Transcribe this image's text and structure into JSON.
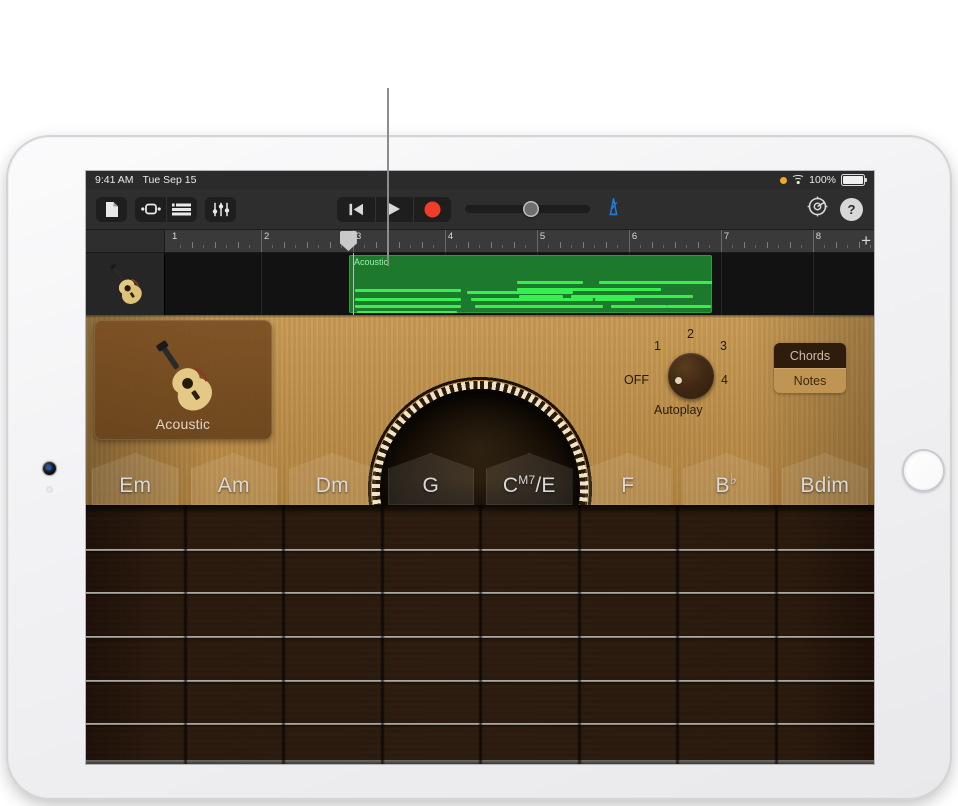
{
  "callout": {
    "name": "callout-line"
  },
  "device": {
    "name": "iPad",
    "camera_icon": "camera-icon",
    "home_button": "home-button"
  },
  "status_bar": {
    "time": "9:41 AM",
    "date": "Tue Sep 15",
    "focus_indicator": "orange-dot-icon",
    "wifi_icon": "wifi-icon",
    "battery_percent": "100%",
    "battery_icon": "battery-icon"
  },
  "toolbar": {
    "left_buttons": [
      {
        "name": "my-songs-button",
        "icon": "document-icon",
        "label": "My Songs"
      },
      {
        "name": "loop-browser-button",
        "icon": "loop-browser-icon",
        "label": "Loop Browser"
      },
      {
        "name": "track-view-button",
        "icon": "tracks-view-icon",
        "label": "Tracks View"
      },
      {
        "name": "mixer-button",
        "icon": "mixer-sliders-icon",
        "label": "Mixer"
      }
    ],
    "transport": [
      {
        "name": "rewind-button",
        "icon": "rewind-icon",
        "label": "Go to Beginning"
      },
      {
        "name": "play-button",
        "icon": "play-icon",
        "label": "Play"
      },
      {
        "name": "record-button",
        "icon": "record-icon",
        "label": "Record"
      }
    ],
    "volume": {
      "label": "Master Volume",
      "value": 46
    },
    "metronome": {
      "name": "metronome-button",
      "icon": "metronome-icon",
      "label": "Metronome"
    },
    "settings": {
      "name": "settings-button",
      "icon": "gear-icon",
      "label": "Song Settings"
    },
    "help": {
      "name": "help-button",
      "icon": "question-mark-icon",
      "label": "?"
    }
  },
  "ruler": {
    "bars": [
      "1",
      "2",
      "3",
      "4",
      "5",
      "6",
      "7",
      "8"
    ],
    "playhead_bar": "3",
    "add_track_label": "+"
  },
  "track": {
    "header_icon": "acoustic-guitar-icon",
    "region_name": "Acoustic"
  },
  "instrument": {
    "card_label": "Acoustic",
    "card_icon": "acoustic-guitar-icon"
  },
  "autoplay": {
    "label": "Autoplay",
    "off_label": "OFF",
    "positions": [
      "1",
      "2",
      "3",
      "4"
    ],
    "selected": "OFF"
  },
  "mode_switch": {
    "chords_label": "Chords",
    "notes_label": "Notes",
    "selected": "Notes"
  },
  "chord_strip": {
    "chords": [
      {
        "root": "Em",
        "sup": "",
        "bass": ""
      },
      {
        "root": "Am",
        "sup": "",
        "bass": ""
      },
      {
        "root": "Dm",
        "sup": "",
        "bass": ""
      },
      {
        "root": "G",
        "sup": "",
        "bass": ""
      },
      {
        "root": "C",
        "sup": "M7",
        "bass": "/E"
      },
      {
        "root": "F",
        "sup": "",
        "bass": ""
      },
      {
        "root": "B",
        "sup": "",
        "bass": "",
        "flat": "♭"
      },
      {
        "root": "Bdim",
        "sup": "",
        "bass": ""
      }
    ]
  },
  "fretboard": {
    "string_count": 6,
    "column_count": 8
  },
  "colors": {
    "region_green": "#1d7a2c",
    "note_green": "#37f050",
    "record_red": "#f23c2a",
    "accent_blue": "#1e7ce0",
    "wood_light": "#c89a54",
    "fretboard_dark": "#2c1b0e"
  }
}
